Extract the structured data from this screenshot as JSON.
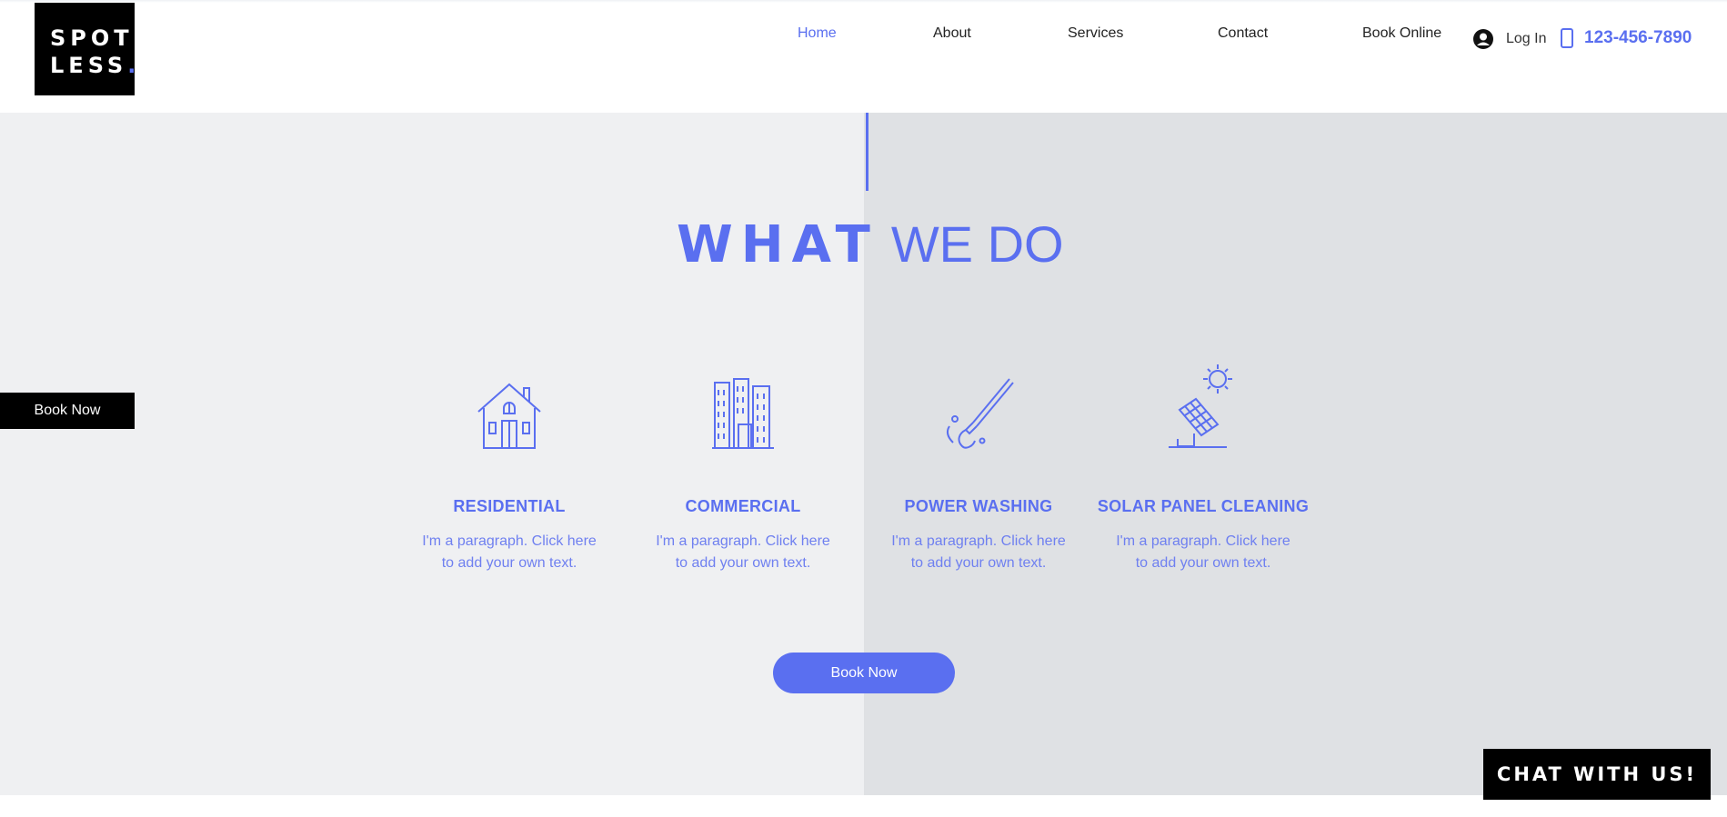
{
  "logo": {
    "line1": "SPOT",
    "line2": "LESS",
    "dot": "."
  },
  "nav": [
    {
      "label": "Home",
      "active": true
    },
    {
      "label": "About",
      "active": false
    },
    {
      "label": "Services",
      "active": false
    },
    {
      "label": "Contact",
      "active": false
    },
    {
      "label": "Book Online",
      "active": false
    }
  ],
  "account": {
    "login_label": "Log In",
    "icon": "user-avatar-icon"
  },
  "phone": {
    "number": "123-456-7890",
    "icon": "phone-icon"
  },
  "section": {
    "title_bold": "WHAT",
    "title_light": "WE DO"
  },
  "services": [
    {
      "name": "RESIDENTIAL",
      "desc_line1": "I'm a paragraph. Click here",
      "desc_line2": "to add your own text.",
      "icon": "house-icon"
    },
    {
      "name": "COMMERCIAL",
      "desc_line1": "I'm a paragraph. Click here",
      "desc_line2": "to add your own text.",
      "icon": "buildings-icon"
    },
    {
      "name": "POWER WASHING",
      "desc_line1": "I'm a paragraph. Click here",
      "desc_line2": "to add your own text.",
      "icon": "power-washer-icon"
    },
    {
      "name": "SOLAR PANEL CLEANING",
      "desc_line1": "I'm a paragraph. Click here",
      "desc_line2": "to add your own text.",
      "icon": "solar-panel-icon"
    }
  ],
  "buttons": {
    "book_side": "Book Now",
    "book_main": "Book Now",
    "chat": "CHAT WITH US!"
  },
  "colors": {
    "accent": "#5a6ff0",
    "left_bg": "#eff0f2",
    "right_bg": "#dfe1e4",
    "black": "#000000"
  }
}
